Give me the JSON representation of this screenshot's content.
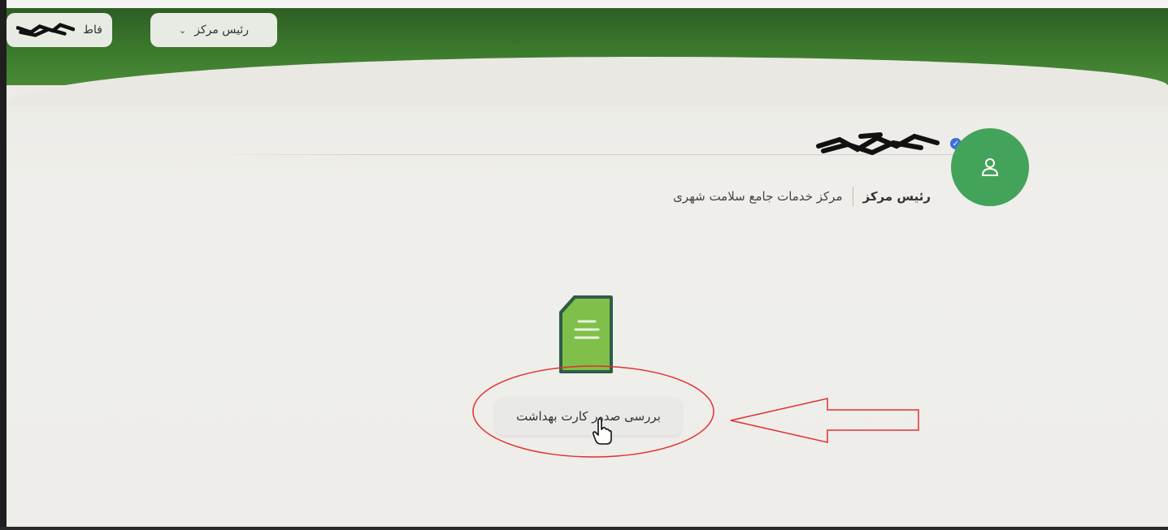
{
  "header": {
    "user_chip_text": "فاط",
    "role_selector": {
      "label": "رئیس مرکز",
      "icon": "chevron-down-icon"
    }
  },
  "profile": {
    "verified_icon": "verified-badge-icon",
    "avatar_icon": "user-icon",
    "role_title": "رئیس مرکز",
    "organization": "مرکز خدمات جامع سلامت شهری"
  },
  "tile": {
    "icon": "document-icon",
    "label": "بررسی صدور کارت بهداشت"
  },
  "colors": {
    "header_green": "#3b7a2d",
    "avatar_green": "#43a35a",
    "annotation_red": "#e03030"
  }
}
